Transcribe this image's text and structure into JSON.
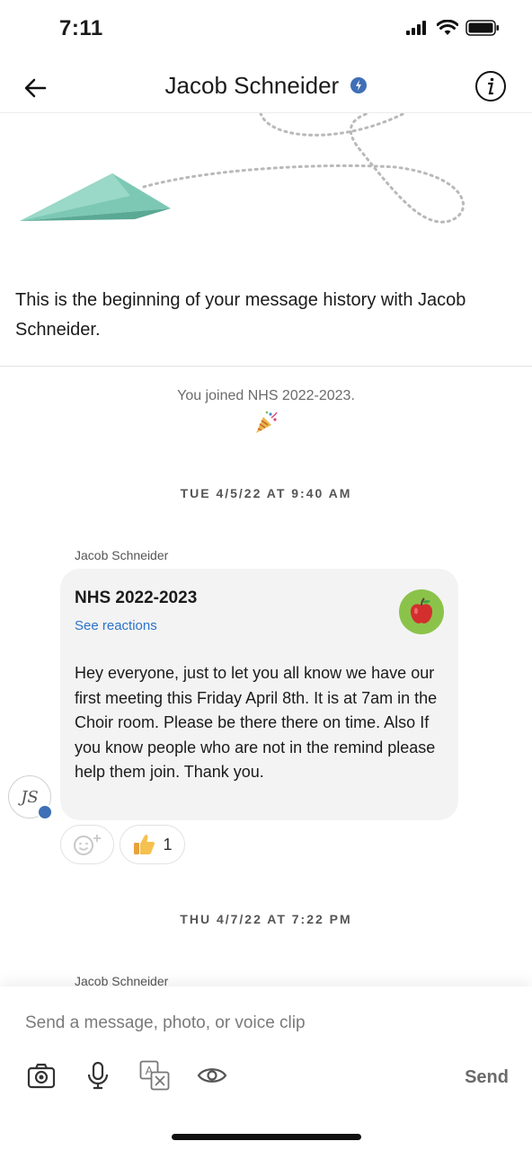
{
  "status_bar": {
    "time": "7:11"
  },
  "header": {
    "title": "Jacob Schneider"
  },
  "intro": {
    "text": "This is the beginning of your message history with Jacob Schneider.",
    "joined": "You joined NHS 2022-2023."
  },
  "dates": {
    "first": "TUE 4/5/22 AT 9:40 AM",
    "second": "THU 4/7/22 AT 7:22 PM"
  },
  "message": {
    "sender": "Jacob Schneider",
    "title": "NHS 2022-2023",
    "see_reactions": "See reactions",
    "body": "Hey everyone, just to let you all know we have our first meeting this Friday April 8th. It is at 7am in the Choir room. Please be there there on time. Also If you know people who are not in the remind please help them join. Thank you.",
    "avatar_initials": "JS",
    "reactions": [
      {
        "icon": "thumbs-up-icon",
        "count": "1"
      }
    ]
  },
  "next_message": {
    "sender": "Jacob Schneider"
  },
  "composer": {
    "placeholder": "Send a message, photo, or voice clip",
    "send_label": "Send"
  },
  "colors": {
    "accent_link": "#2b73c9",
    "verified_badge": "#3f6fb6",
    "plane": "#6fbfaa",
    "group_avatar": "#8bc34a"
  }
}
